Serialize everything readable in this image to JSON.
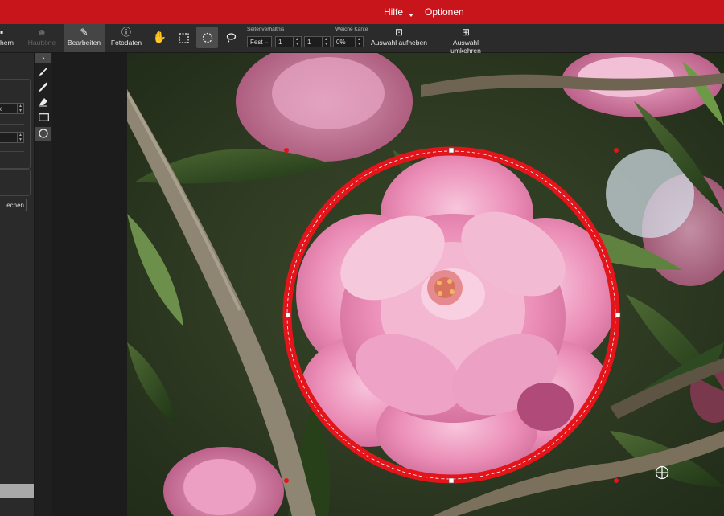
{
  "menu": {
    "help": "Hilfe",
    "options": "Optionen"
  },
  "toolbar": {
    "partial_save": "hern",
    "disabled_button": "Hauttöne",
    "edit": "Bearbeiten",
    "photo_data": "Fotodaten",
    "aspect_label": "Seitenverhältnis",
    "aspect_mode": "Fest",
    "aspect_w": "1",
    "aspect_h": "1",
    "feather_label": "Weiche Kante",
    "feather_value": "0%",
    "deselect": "Auswahl aufheben",
    "invert": "Auswahl umkehren"
  },
  "leftpanel": {
    "unit_fragment": "x",
    "button_fragment": "echen"
  },
  "colors": {
    "brand": "#c8141b",
    "selection": "#e4141b"
  },
  "icons": {
    "save": "save-icon",
    "edit": "edit-icon",
    "info": "info-icon",
    "hand": "hand-icon",
    "rect": "rect-select-icon",
    "ellipse": "ellipse-select-icon",
    "lasso": "lasso-icon",
    "brush": "brush-icon",
    "pencil": "pencil-icon",
    "eraser": "eraser-icon"
  }
}
